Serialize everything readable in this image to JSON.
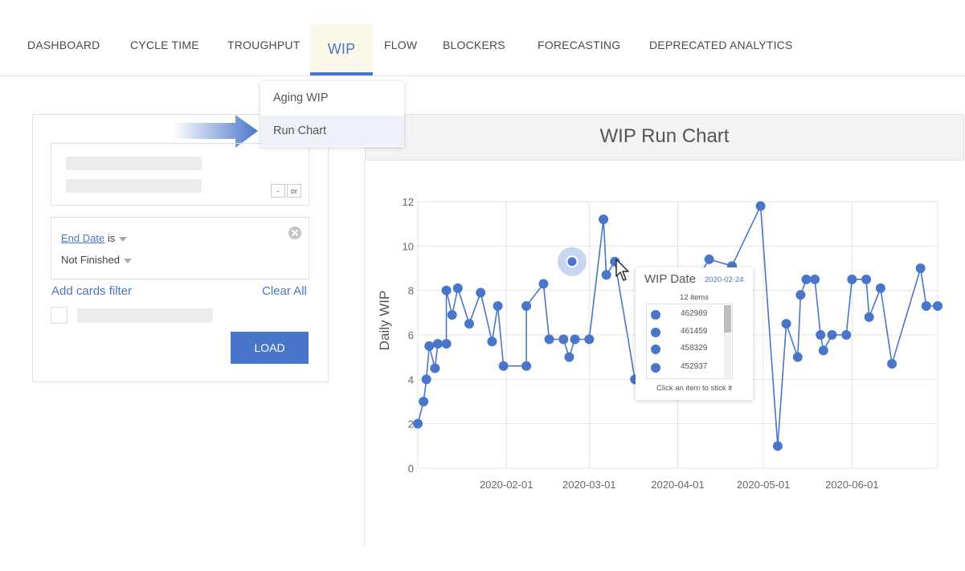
{
  "nav": {
    "tabs": [
      "DASHBOARD",
      "CYCLE TIME",
      "TROUGHPUT",
      "WIP",
      "FLOW",
      "BLOCKERS",
      "FORECASTING",
      "DEPRECATED ANALYTICS"
    ]
  },
  "dropdown": {
    "items": [
      "Aging WIP",
      "Run Chart"
    ]
  },
  "filter": {
    "mini_buttons": [
      "-",
      "or"
    ],
    "condition_field": "End Date",
    "condition_op": "is",
    "condition_value": "Not Finished",
    "add_filter_label": "Add cards filter",
    "clear_all_label": "Clear All",
    "load_label": "LOAD"
  },
  "chart": {
    "title": "WIP Run Chart",
    "ylabel": "Daily WIP",
    "accent": "#4a76c9"
  },
  "chart_data": {
    "type": "line",
    "title": "WIP Run Chart",
    "ylabel": "Daily WIP",
    "xlabel": "",
    "ylim": [
      0,
      12
    ],
    "y_ticks": [
      0,
      2,
      4,
      6,
      8,
      10,
      12
    ],
    "x_tick_labels": [
      "2020-02-01",
      "2020-03-01",
      "2020-04-01",
      "2020-05-01",
      "2020-06-01"
    ],
    "x_range": [
      "2020-01-01",
      "2020-07-01"
    ],
    "grid": true,
    "series": [
      {
        "points": [
          [
            "2020-01-01",
            2
          ],
          [
            "2020-01-03",
            3
          ],
          [
            "2020-01-04",
            4
          ],
          [
            "2020-01-05",
            5.5
          ],
          [
            "2020-01-07",
            4.5
          ],
          [
            "2020-01-08",
            5.6
          ],
          [
            "2020-01-11",
            5.6
          ],
          [
            "2020-01-11",
            8
          ],
          [
            "2020-01-13",
            6.9
          ],
          [
            "2020-01-15",
            8.1
          ],
          [
            "2020-01-19",
            6.5
          ],
          [
            "2020-01-23",
            7.9
          ],
          [
            "2020-01-27",
            5.7
          ],
          [
            "2020-01-29",
            7.3
          ],
          [
            "2020-01-31",
            4.6
          ],
          [
            "2020-02-08",
            4.6
          ],
          [
            "2020-02-08",
            7.3
          ],
          [
            "2020-02-14",
            8.3
          ],
          [
            "2020-02-16",
            5.8
          ],
          [
            "2020-02-21",
            5.8
          ],
          [
            "2020-02-23",
            5.0
          ],
          [
            "2020-02-25",
            5.8
          ],
          [
            "2020-03-01",
            5.8
          ],
          [
            "2020-03-06",
            11.2
          ],
          [
            "2020-03-07",
            8.7
          ],
          [
            "2020-03-10",
            9.3
          ],
          [
            "2020-03-17",
            4.0
          ],
          [
            "2020-04-12",
            9.4
          ],
          [
            "2020-04-20",
            9.1
          ],
          [
            "2020-04-30",
            11.8
          ],
          [
            "2020-05-06",
            1.0
          ],
          [
            "2020-05-09",
            6.5
          ],
          [
            "2020-05-13",
            5.0
          ],
          [
            "2020-05-14",
            7.8
          ],
          [
            "2020-05-16",
            8.5
          ],
          [
            "2020-05-19",
            8.5
          ],
          [
            "2020-05-21",
            6.0
          ],
          [
            "2020-05-22",
            5.3
          ],
          [
            "2020-05-25",
            6.0
          ],
          [
            "2020-05-30",
            6.0
          ],
          [
            "2020-06-01",
            8.5
          ],
          [
            "2020-06-06",
            8.5
          ],
          [
            "2020-06-07",
            6.8
          ],
          [
            "2020-06-11",
            8.1
          ],
          [
            "2020-06-15",
            4.7
          ],
          [
            "2020-06-25",
            9.0
          ],
          [
            "2020-06-27",
            7.3
          ],
          [
            "2020-07-01",
            7.3
          ]
        ]
      }
    ],
    "highlight_point": [
      "2020-02-24",
      9.3
    ]
  },
  "tooltip": {
    "title": "WIP Date",
    "date": "2020-02-24",
    "count_label": "12 items",
    "items": [
      "462989",
      "461459",
      "458329",
      "452937"
    ],
    "hint": "Click an item to stick it"
  }
}
